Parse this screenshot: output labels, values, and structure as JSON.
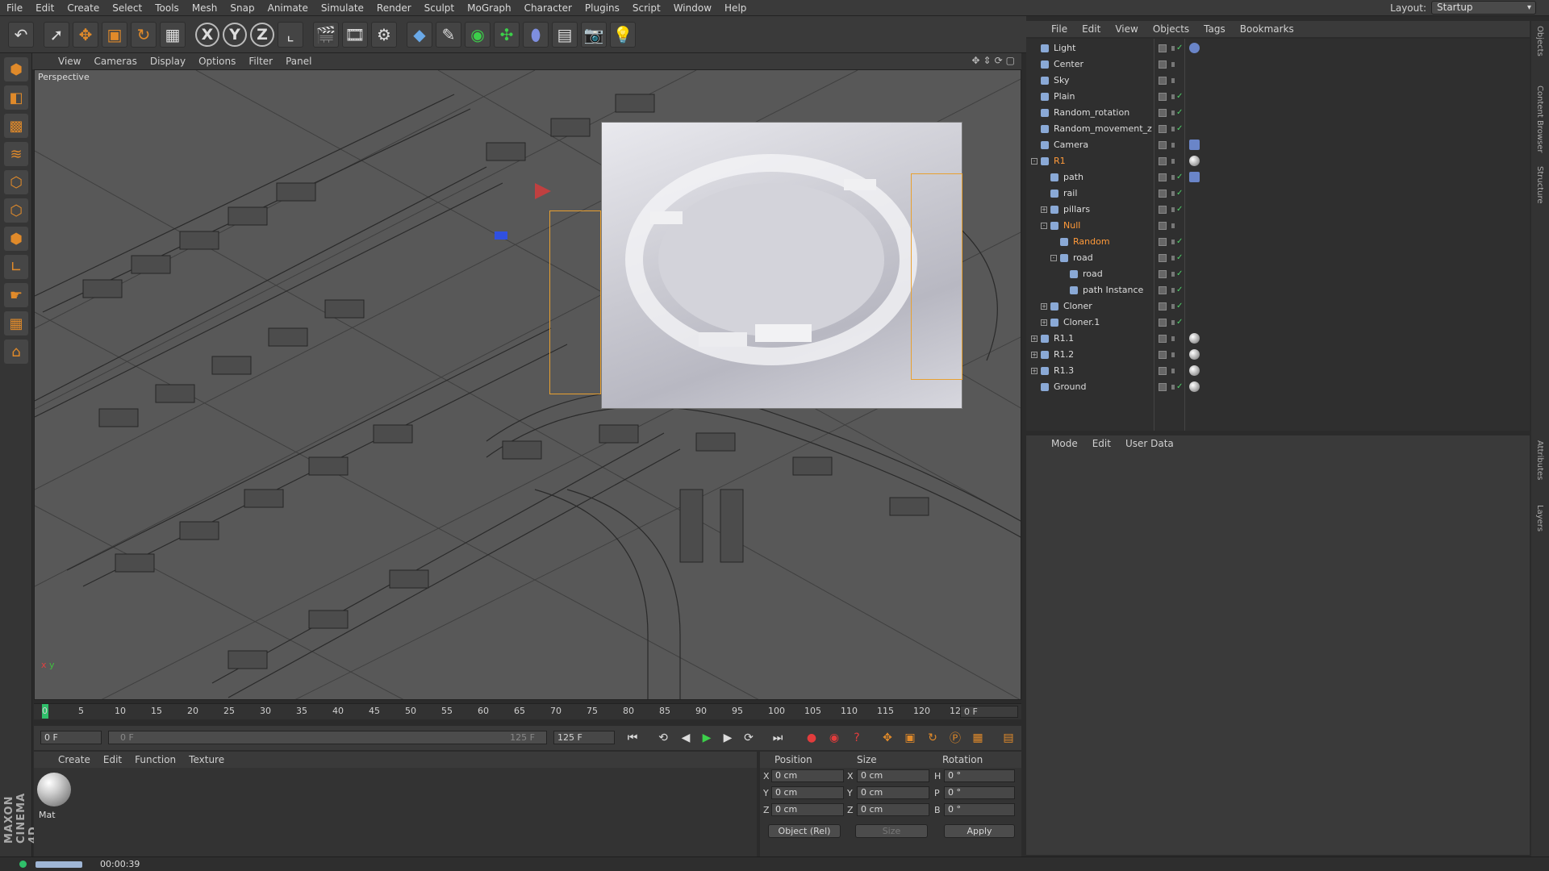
{
  "menu": [
    "File",
    "Edit",
    "Create",
    "Select",
    "Tools",
    "Mesh",
    "Snap",
    "Animate",
    "Simulate",
    "Render",
    "Sculpt",
    "MoGraph",
    "Character",
    "Plugins",
    "Script",
    "Window",
    "Help"
  ],
  "layout": {
    "label": "Layout:",
    "value": "Startup"
  },
  "toolbar": {
    "axis_x": "X",
    "axis_y": "Y",
    "axis_z": "Z",
    "icons": [
      "undo-icon",
      "select-arrow-icon",
      "move-icon",
      "scale-icon",
      "rotate-icon",
      "render-region-icon",
      "coordinate-system-icon",
      "render-view-icon",
      "render-picture-viewer-icon",
      "edit-render-settings-icon",
      "cube-icon",
      "pen-spline-icon",
      "subdivision-icon",
      "array-icon",
      "deformer-icon",
      "floor-icon",
      "camera-icon",
      "light-icon"
    ]
  },
  "viewport": {
    "menu": [
      "View",
      "Cameras",
      "Display",
      "Options",
      "Filter",
      "Panel"
    ],
    "label": "Perspective"
  },
  "timeline": {
    "ticks": [
      "0",
      "5",
      "10",
      "15",
      "20",
      "25",
      "30",
      "35",
      "40",
      "45",
      "50",
      "55",
      "60",
      "65",
      "70",
      "75",
      "80",
      "85",
      "90",
      "95",
      "100",
      "105",
      "110",
      "115",
      "120",
      "12"
    ],
    "current_frame": "0 F",
    "start": "0 F",
    "range_start": "0 F",
    "range_end": "125 F",
    "end": "125 F"
  },
  "material_manager": {
    "menu": [
      "Create",
      "Edit",
      "Function",
      "Texture"
    ],
    "materials": [
      {
        "name": "Mat"
      }
    ]
  },
  "coordinates": {
    "col_position": "Position",
    "col_size": "Size",
    "col_rotation": "Rotation",
    "rows": [
      {
        "axis": "X",
        "pos": "0 cm",
        "saxis": "X",
        "size": "0 cm",
        "raxis": "H",
        "rot": "0 °"
      },
      {
        "axis": "Y",
        "pos": "0 cm",
        "saxis": "Y",
        "size": "0 cm",
        "raxis": "P",
        "rot": "0 °"
      },
      {
        "axis": "Z",
        "pos": "0 cm",
        "saxis": "Z",
        "size": "0 cm",
        "raxis": "B",
        "rot": "0 °"
      }
    ],
    "mode": "Object (Rel)",
    "size_mode": "Size",
    "apply": "Apply"
  },
  "object_manager": {
    "menu": [
      "File",
      "Edit",
      "View",
      "Objects",
      "Tags",
      "Bookmarks"
    ],
    "objects": [
      {
        "name": "Light",
        "depth": 0,
        "expand": "",
        "check": true,
        "tag": "light-tag"
      },
      {
        "name": "Center",
        "depth": 0,
        "expand": "",
        "check": false,
        "tag": ""
      },
      {
        "name": "Sky",
        "depth": 0,
        "expand": "",
        "check": false,
        "tag": ""
      },
      {
        "name": "Plain",
        "depth": 0,
        "expand": "",
        "check": true,
        "tag": ""
      },
      {
        "name": "Random_rotation",
        "depth": 0,
        "expand": "",
        "check": true,
        "tag": ""
      },
      {
        "name": "Random_movement_z",
        "depth": 0,
        "expand": "",
        "check": true,
        "tag": ""
      },
      {
        "name": "Camera",
        "depth": 0,
        "expand": "",
        "check": false,
        "tag": "camera-tag"
      },
      {
        "name": "R1",
        "depth": 0,
        "expand": "-",
        "check": false,
        "tag": "material-tag",
        "highlight": true
      },
      {
        "name": "path",
        "depth": 1,
        "expand": "",
        "check": true,
        "tag": "spline-tag"
      },
      {
        "name": "rail",
        "depth": 1,
        "expand": "",
        "check": true,
        "tag": ""
      },
      {
        "name": "pillars",
        "depth": 1,
        "expand": "+",
        "check": true,
        "tag": ""
      },
      {
        "name": "Null",
        "depth": 1,
        "expand": "-",
        "check": false,
        "tag": "",
        "highlight": true
      },
      {
        "name": "Random",
        "depth": 2,
        "expand": "",
        "check": true,
        "tag": "",
        "highlight": true
      },
      {
        "name": "road",
        "depth": 2,
        "expand": "-",
        "check": true,
        "tag": ""
      },
      {
        "name": "road",
        "depth": 3,
        "expand": "",
        "check": true,
        "tag": ""
      },
      {
        "name": "path Instance",
        "depth": 3,
        "expand": "",
        "check": true,
        "tag": ""
      },
      {
        "name": "Cloner",
        "depth": 1,
        "expand": "+",
        "check": true,
        "tag": ""
      },
      {
        "name": "Cloner.1",
        "depth": 1,
        "expand": "+",
        "check": true,
        "tag": ""
      },
      {
        "name": "R1.1",
        "depth": 0,
        "expand": "+",
        "check": false,
        "tag": "material-tag"
      },
      {
        "name": "R1.2",
        "depth": 0,
        "expand": "+",
        "check": false,
        "tag": "material-tag"
      },
      {
        "name": "R1.3",
        "depth": 0,
        "expand": "+",
        "check": false,
        "tag": "material-tag"
      },
      {
        "name": "Ground",
        "depth": 0,
        "expand": "",
        "check": true,
        "tag": "material-tag"
      }
    ]
  },
  "attribute_manager": {
    "menu": [
      "Mode",
      "Edit",
      "User Data"
    ]
  },
  "side_tabs": [
    "Objects",
    "Content Browser",
    "Structure",
    "Attributes",
    "Layers"
  ],
  "status": {
    "time": "00:00:39",
    "brand": "MAXON CINEMA 4D"
  },
  "colors": {
    "accent": "#e08a2a",
    "highlight": "#ff9a3a",
    "play": "#2fc06a",
    "check": "#4fd36a"
  }
}
